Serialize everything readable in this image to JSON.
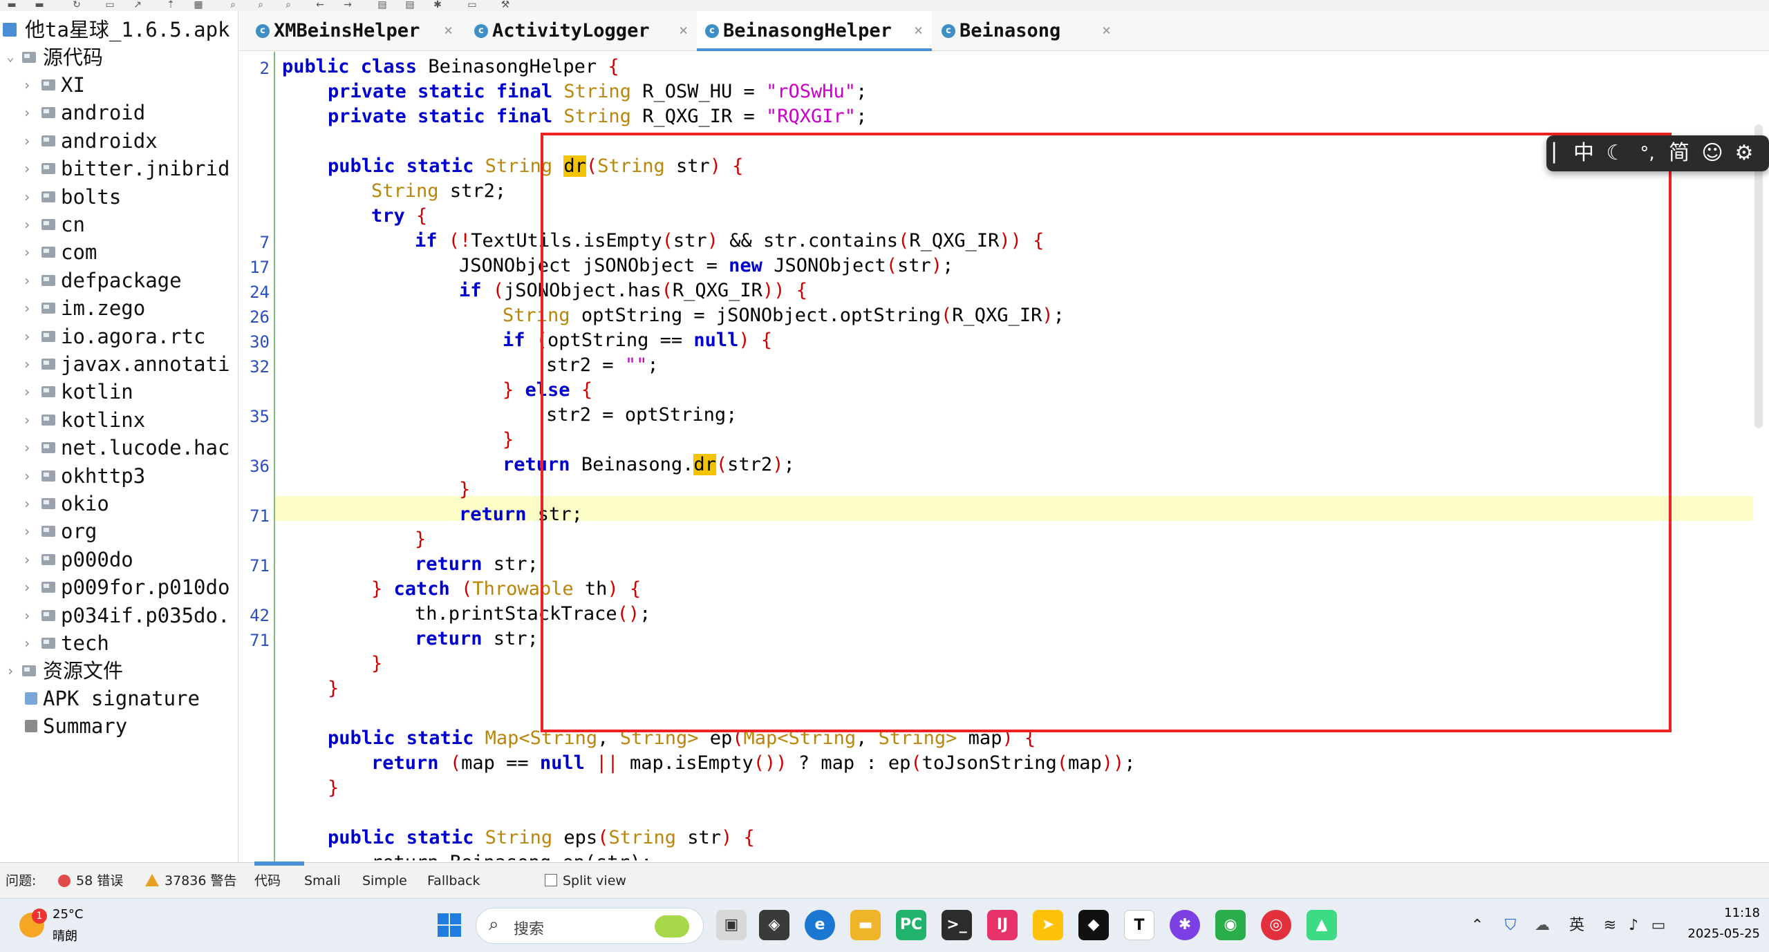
{
  "tree": {
    "root_label": "他ta星球_1.6.5.apk",
    "source_label": "源代码",
    "packages": [
      "XI",
      "android",
      "androidx",
      "bitter.jnibrid",
      "bolts",
      "cn",
      "com",
      "defpackage",
      "im.zego",
      "io.agora.rtc",
      "javax.annotati",
      "kotlin",
      "kotlinx",
      "net.lucode.hac",
      "okhttp3",
      "okio",
      "org",
      "p000do",
      "p009for.p010do",
      "p034if.p035do.",
      "tech"
    ],
    "resources_label": "资源文件",
    "apk_signature_label": "APK signature",
    "summary_label": "Summary"
  },
  "tabs": [
    {
      "name": "XMBeinsHelper"
    },
    {
      "name": "ActivityLogger"
    },
    {
      "name": "BeinasongHelper"
    },
    {
      "name": "Beinasong"
    }
  ],
  "editor": {
    "line_numbers": [
      "2",
      "7",
      "17",
      "24",
      "26",
      "30",
      "32",
      "35",
      "36",
      "71",
      "71",
      "42",
      "71"
    ],
    "code": {
      "class_name": "BeinasongHelper",
      "const1_name": "R_OSW_HU",
      "const1_value": "\"rOSwHu\"",
      "const2_name": "R_QXG_IR",
      "const2_value": "\"RQXGIr\"",
      "method_dr": "dr",
      "local_str2": "str2",
      "textutils_call": "TextUtils.isEmpty",
      "contains_call": "str.contains",
      "json_class": "JSONObject",
      "json_var": "jSONObject",
      "has_call": "jSONObject.has",
      "optstring_var": "optString",
      "optstring_call": "jSONObject.optString",
      "empty_string": "\"\"",
      "return_call_owner": "Beinasong.",
      "print_trace": "th.printStackTrace",
      "method_ep": "ep",
      "map_isempty": "map.isEmpty",
      "tojson": "toJsonString",
      "method_eps": "eps",
      "partial_last": "return Beinasong.ep(str);"
    }
  },
  "ime": {
    "items": [
      "中",
      "☾",
      "°,",
      "简",
      "☺",
      "⚙"
    ]
  },
  "statusbar": {
    "problems_label": "问题:",
    "errors_label": "58 错误",
    "warnings_label": "37836 警告",
    "view_tabs": [
      "代码",
      "Smali",
      "Simple",
      "Fallback"
    ],
    "split_view_label": "Split view"
  },
  "taskbar": {
    "weather_temp": "25°C",
    "weather_desc": "晴朗",
    "weather_badge": "1",
    "search_placeholder": "搜索",
    "ime_lang": "英",
    "time": "11:18",
    "date": "2025-05-25"
  },
  "colors": {
    "keyword": "#0000cc",
    "type": "#b8860b",
    "string": "#c800c8",
    "punct": "#cc0000",
    "highlight_line": "#fdfdc8",
    "search_mark": "#f5c400",
    "red_box": "#ee2222"
  }
}
